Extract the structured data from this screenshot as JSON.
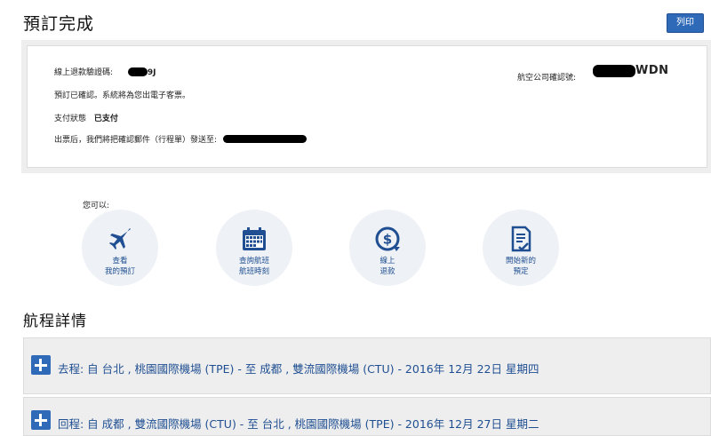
{
  "header": {
    "title": "預訂完成",
    "print_label": "列印"
  },
  "confirmation": {
    "refund_code_label": "線上退款驗證碼:",
    "refund_code_visible": "9J",
    "confirmed_text": "預訂已確認。系統將為您出電子客票。",
    "payment_status_label": "支付狀態",
    "payment_status_value": "已支付",
    "email_notice": "出票后，我們將把確認郵件（行程單）發送至:",
    "airline_confirm_label": "航空公司確認號:",
    "airline_confirm_visible": "WDN"
  },
  "actions": {
    "intro": "您可以:",
    "items": [
      {
        "line1": "查看",
        "line2": "我的預訂",
        "icon": "airplane-icon"
      },
      {
        "line1": "查詢航班",
        "line2": "航班時刻",
        "icon": "calendar-icon"
      },
      {
        "line1": "線上",
        "line2": "退款",
        "icon": "refund-icon"
      },
      {
        "line1": "開始新的",
        "line2": "預定",
        "icon": "document-icon"
      }
    ]
  },
  "itinerary": {
    "title": "航程詳情",
    "legs": [
      {
        "text": "去程:  自   台北 , 桃園國際機場 (TPE) -    至    成都 , 雙流國際機場 (CTU) - 2016年 12月 22日 星期四"
      },
      {
        "text": "回程:  自   成都 , 雙流國際機場 (CTU) -    至    台北 , 桃園國際機場 (TPE) - 2016年 12月 27日 星期二"
      }
    ]
  },
  "colors": {
    "accent": "#2f6ab8",
    "link": "#1f4f92",
    "panel": "#eeeeee"
  }
}
